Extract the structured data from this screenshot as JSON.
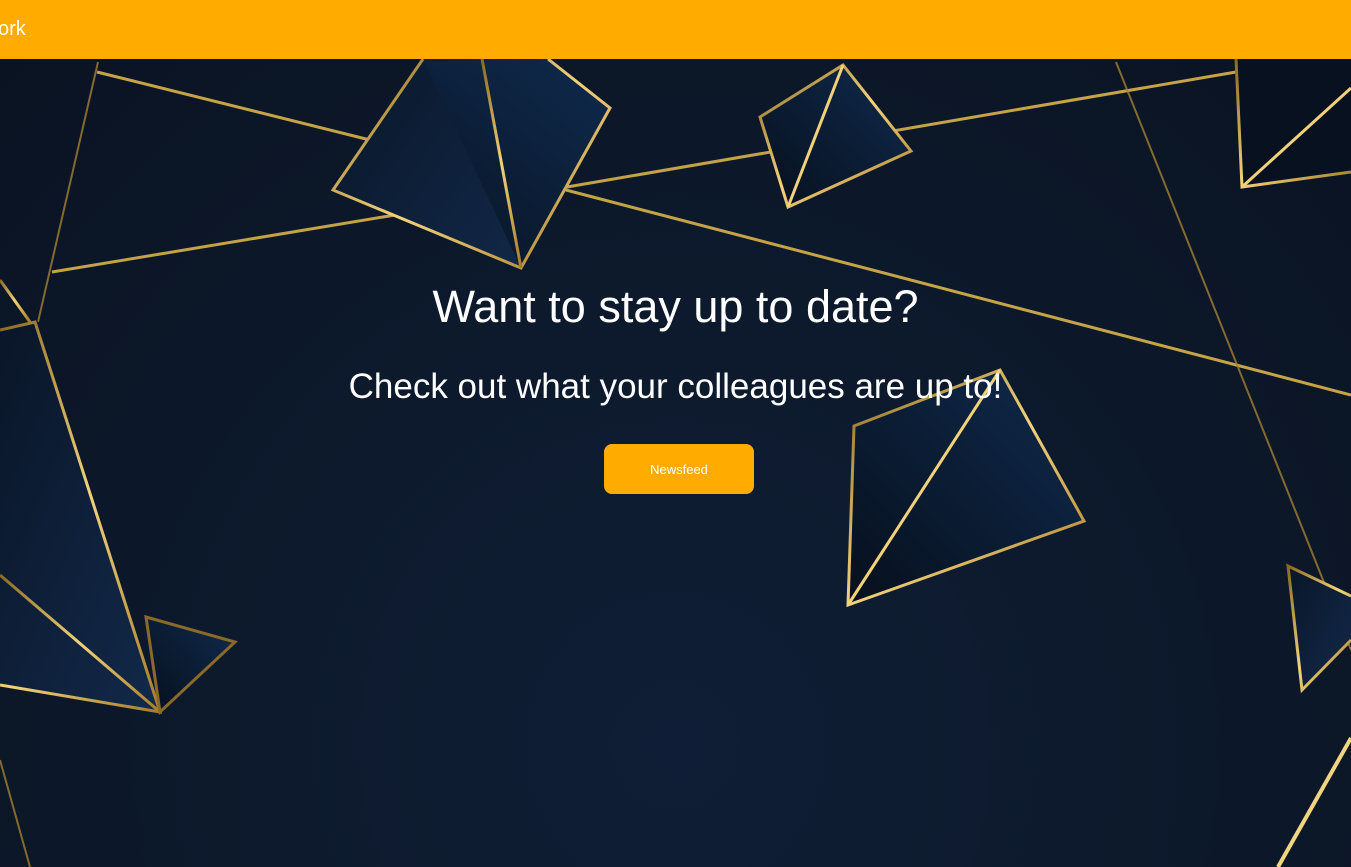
{
  "header": {
    "brand": "twork"
  },
  "hero": {
    "headline": "Want to stay up to date?",
    "subline": "Check out what your colleagues are up to!",
    "button_label": "Newsfeed"
  },
  "colors": {
    "accent": "#ffab00",
    "background": "#0d1a2e",
    "gold_lines": "#d9b24a",
    "text": "#ffffff"
  }
}
